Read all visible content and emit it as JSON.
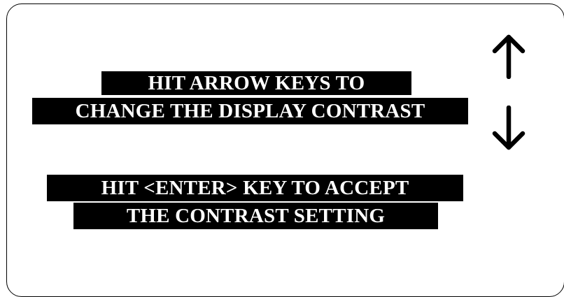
{
  "instructions": {
    "contrast_line1": "HIT ARROW KEYS TO",
    "contrast_line2": "CHANGE THE DISPLAY CONTRAST",
    "accept_line1": "HIT <ENTER> KEY TO ACCEPT",
    "accept_line2": "THE CONTRAST SETTING"
  },
  "icons": {
    "up": "up-arrow-icon",
    "down": "down-arrow-icon"
  },
  "colors": {
    "band_background": "#000000",
    "band_text": "#ffffff",
    "page_background": "#ffffff"
  }
}
